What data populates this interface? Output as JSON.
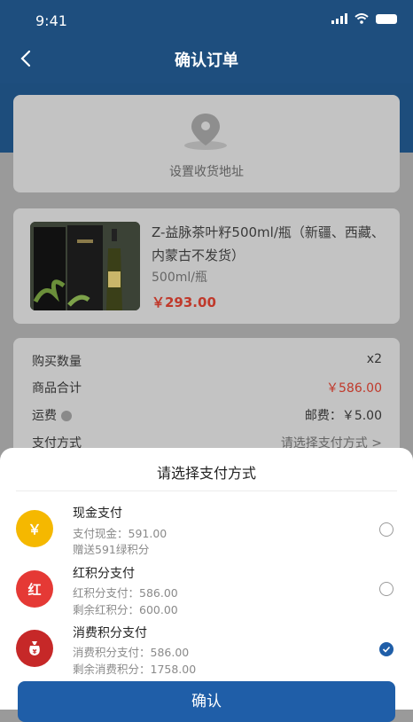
{
  "status_bar": {
    "time": "9:41"
  },
  "header": {
    "title": "确认订单"
  },
  "address": {
    "placeholder": "设置收货地址"
  },
  "product": {
    "title": "Z-益脉茶叶籽500ml/瓶（新疆、西藏、内蒙古不发货）",
    "spec": "500ml/瓶",
    "price": "￥293.00"
  },
  "order_info": {
    "quantity_label": "购买数量",
    "quantity_value": "x2",
    "subtotal_label": "商品合计",
    "subtotal_value": "￥586.00",
    "shipping_label": "运费",
    "shipping_value": "邮费：￥5.00",
    "payment_label": "支付方式",
    "payment_value": "请选择支付方式 >"
  },
  "payment_sheet": {
    "title": "请选择支付方式",
    "methods": [
      {
        "icon": "yen-icon",
        "icon_text": "￥",
        "color": "#f5b800",
        "name": "现金支付",
        "line1": "支付现金：591.00",
        "line2": "赠送591绿积分",
        "selected": false
      },
      {
        "icon": "red-points-icon",
        "icon_text": "红",
        "color": "#e53935",
        "name": "红积分支付",
        "line1": "红积分支付：586.00",
        "line2": "剩余红积分：600.00",
        "selected": false
      },
      {
        "icon": "money-bag-icon",
        "icon_text": "",
        "color": "#c62828",
        "name": "消费积分支付",
        "line1": "消费积分支付：586.00",
        "line2": "剩余消费积分：1758.00",
        "selected": true
      }
    ],
    "confirm_label": "确认"
  }
}
